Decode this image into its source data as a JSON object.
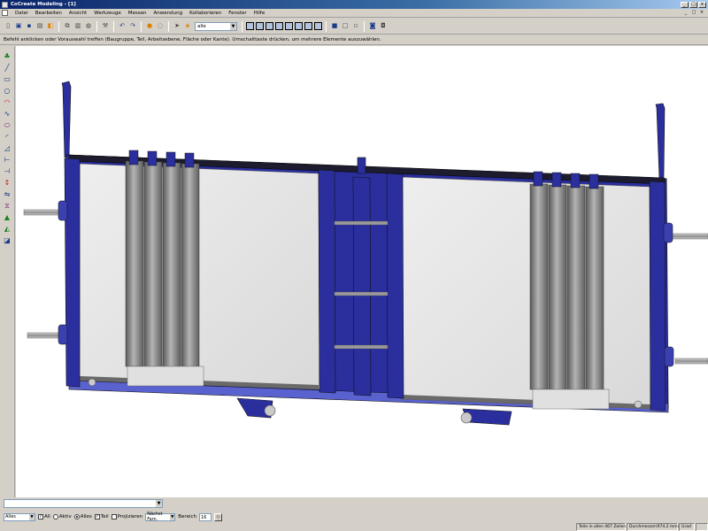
{
  "window": {
    "title": "CoCreate Modeling - [1]",
    "buttons": [
      "_",
      "□",
      "×"
    ]
  },
  "menu": {
    "items": [
      "Datei",
      "Bearbeiten",
      "Ansicht",
      "Werkzeuge",
      "Messen",
      "Anwendung",
      "Kollaborieren",
      "Fenster",
      "Hilfe"
    ],
    "mdi_buttons": [
      "_",
      "□",
      "×"
    ]
  },
  "toolbar": {
    "view_select": "alle"
  },
  "prompt": {
    "text": "Befehl anklicken oder Vorauswahl treffen (Baugruppe, Teil, Arbeitsebene, Fläche oder Kante). Umschalttaste drücken, um mehrere Elemente auszuwählen."
  },
  "statusbar": {
    "scope_select": "Alles",
    "check_all": "All",
    "radio_active": "Aktiv",
    "radio_alles": "Alles",
    "check_teil": "Teil",
    "check_projizieren": "Projizieren",
    "nachst_select": "Nächst Fam.",
    "bereich_label": "Bereich",
    "bereich_value": "16"
  },
  "infobar": {
    "teile_info": "Teile in allen 467 Zeilen",
    "speicher_info": "Durchmesser(974.2 mm)",
    "grad_info": "Grad"
  },
  "colors": {
    "frame_blue": "#2b2f9e",
    "panel_gray": "#e3e3e3",
    "roller_gray": "#8a8a8a",
    "viewport_bg": "#ffffff"
  }
}
